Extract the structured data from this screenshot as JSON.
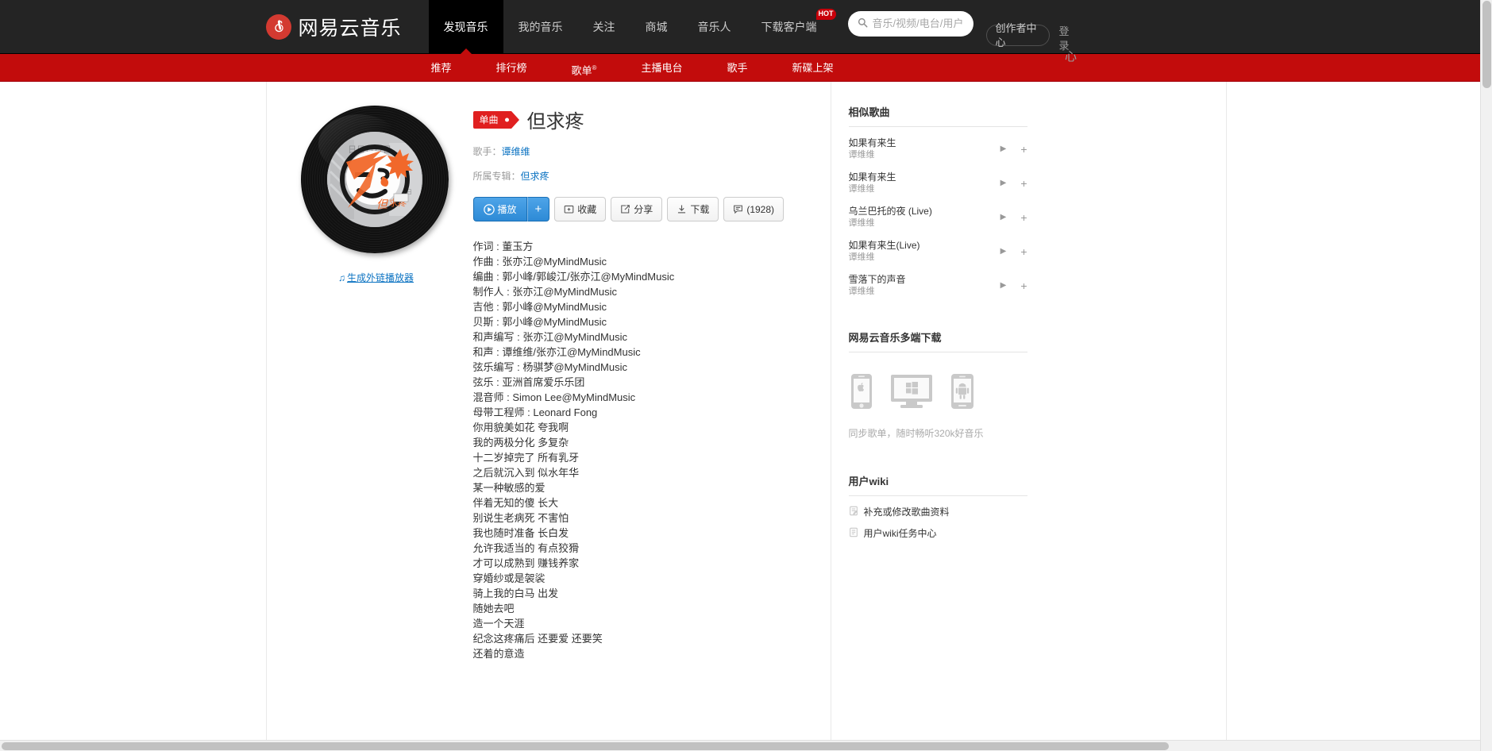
{
  "header": {
    "brand": "网易云音乐",
    "brand_icon": "netease-music-logo-icon",
    "nav": [
      {
        "label": "发现音乐",
        "active": true
      },
      {
        "label": "我的音乐",
        "active": false
      },
      {
        "label": "关注",
        "active": false
      },
      {
        "label": "商城",
        "active": false
      },
      {
        "label": "音乐人",
        "active": false
      },
      {
        "label": "下载客户端",
        "active": false,
        "badge": "HOT"
      }
    ],
    "search": {
      "placeholder": "音乐/视频/电台/用户",
      "value": ""
    },
    "creator_center": "创作者中心",
    "login": "登录"
  },
  "subnav": {
    "items": [
      {
        "label": "推荐",
        "sup": ""
      },
      {
        "label": "排行榜",
        "sup": ""
      },
      {
        "label": "歌单",
        "sup": "®"
      },
      {
        "label": "主播电台",
        "sup": ""
      },
      {
        "label": "歌手",
        "sup": ""
      },
      {
        "label": "新碟上架",
        "sup": ""
      }
    ]
  },
  "song": {
    "badge": "单曲",
    "title": "但求疼",
    "artist_label": "歌手：",
    "artist": "谭维维",
    "album_label": "所属专辑：",
    "album": "但求疼",
    "outlink": "生成外链播放器",
    "buttons": {
      "play": "播放",
      "plus": "+",
      "collect": "收藏",
      "share": "分享",
      "download": "下载",
      "comments": "(1928)"
    },
    "lyrics": [
      "作词 : 董玉方",
      "作曲 : 张亦江@MyMindMusic",
      "编曲 : 郭小峰/郭峻江/张亦江@MyMindMusic",
      "制作人 : 张亦江@MyMindMusic",
      "吉他 : 郭小峰@MyMindMusic",
      "贝斯 : 郭小峰@MyMindMusic",
      "和声编写 : 张亦江@MyMindMusic",
      "和声 : 谭维维/张亦江@MyMindMusic",
      "弦乐编写 : 杨骐梦@MyMindMusic",
      "弦乐 : 亚洲首席爱乐乐团",
      "混音师 : Simon Lee@MyMindMusic",
      "母带工程师 : Leonard Fong",
      "你用貌美如花 夸我啊",
      "我的两极分化 多复杂",
      "十二岁掉完了 所有乳牙",
      "之后就沉入到 似水年华",
      "某一种敏感的爱",
      "伴着无知的傻 长大",
      "别说生老病死 不害怕",
      "我也随时准备 长白发",
      "允许我适当的 有点狡猾",
      "才可以成熟到 赚钱养家",
      "穿婚纱或是袈裟",
      "骑上我的白马 出发",
      "随她去吧",
      "造一个天涯",
      "纪念这疼痛后 还要爱 还要笑",
      "还着的意造"
    ]
  },
  "sidebar": {
    "similar_title": "相似歌曲",
    "similar_songs": [
      {
        "name": "如果有来生",
        "artist": "谭维维"
      },
      {
        "name": "如果有来生",
        "artist": "谭维维"
      },
      {
        "name": "乌兰巴托的夜 (Live)",
        "artist": "谭维维"
      },
      {
        "name": "如果有来生(Live)",
        "artist": "谭维维"
      },
      {
        "name": "雪落下的声音",
        "artist": "谭维维"
      }
    ],
    "download_title": "网易云音乐多端下载",
    "download_platforms": [
      "apple-iphone-icon",
      "windows-desktop-icon",
      "android-phone-icon"
    ],
    "download_text": "同步歌单，随时畅听320k好音乐",
    "wiki_title": "用户wiki",
    "wiki_items": [
      {
        "label": "补充或修改歌曲资料",
        "icon": "edit-doc-icon"
      },
      {
        "label": "用户wiki任务中心",
        "icon": "list-doc-icon"
      }
    ]
  },
  "colors": {
    "brand_red": "#c20c0c",
    "logo_red": "#d33a31",
    "link_blue": "#0c73c2",
    "play_blue": "#2d8ad6",
    "nav_dark": "#242424"
  }
}
